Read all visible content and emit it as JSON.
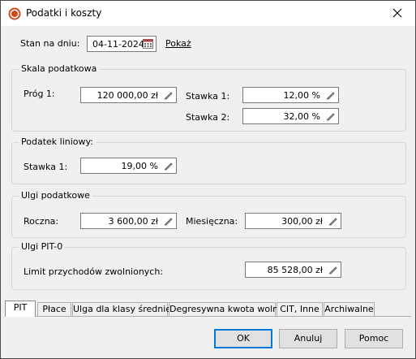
{
  "window": {
    "title": "Podatki i koszty"
  },
  "header": {
    "date_label": "Stan na dniu:",
    "date_value": "04-11-2024",
    "show_link": "Pokaż"
  },
  "skala": {
    "legend": "Skala podatkowa",
    "prog_label": "Próg 1:",
    "prog_value": "120 000,00 zł",
    "stawka1_label": "Stawka 1:",
    "stawka1_value": "12,00 %",
    "stawka2_label": "Stawka 2:",
    "stawka2_value": "32,00 %"
  },
  "liniowy": {
    "legend": "Podatek liniowy:",
    "stawka_label": "Stawka 1:",
    "stawka_value": "19,00 %"
  },
  "ulgi": {
    "legend": "Ulgi podatkowe",
    "roczna_label": "Roczna:",
    "roczna_value": "3 600,00 zł",
    "miesieczna_label": "Miesięczna:",
    "miesieczna_value": "300,00 zł"
  },
  "pit0": {
    "legend": "Ulgi PIT-0",
    "limit_label": "Limit przychodów zwolnionych:",
    "limit_value": "85 528,00 zł"
  },
  "tabs": [
    "PIT",
    "Płace",
    "Ulga dla klasy średniej",
    "Degresywna kwota wolna",
    "CIT, Inne",
    "Archiwalne"
  ],
  "active_tab": "PIT",
  "buttons": {
    "ok": "OK",
    "cancel": "Anuluj",
    "help": "Pomoc"
  },
  "colors": {
    "accent": "#0078d7",
    "icon": "#d04a1e"
  },
  "icons": {
    "app": "app-logo-icon",
    "close": "close-icon",
    "calendar": "calendar-icon",
    "edit": "pencil-icon"
  }
}
